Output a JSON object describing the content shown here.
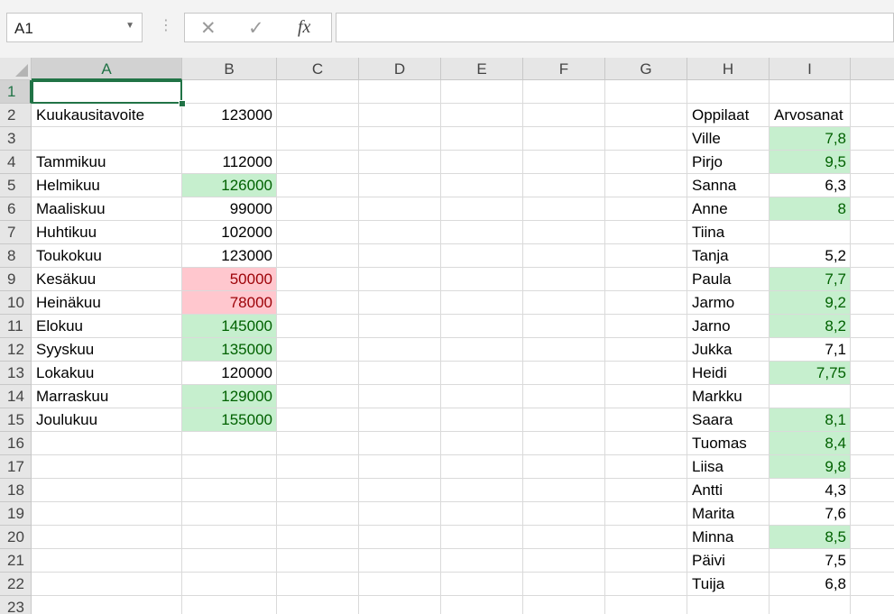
{
  "formula_bar": {
    "name_box": "A1",
    "cancel_icon": "✕",
    "enter_icon": "✓",
    "fx_label": "fx",
    "formula": ""
  },
  "columns": [
    "A",
    "B",
    "C",
    "D",
    "E",
    "F",
    "G",
    "H",
    "I",
    ""
  ],
  "rows": [
    "1",
    "2",
    "3",
    "4",
    "5",
    "6",
    "7",
    "8",
    "9",
    "10",
    "11",
    "12",
    "13",
    "14",
    "15",
    "16",
    "17",
    "18",
    "19",
    "20",
    "21",
    "22",
    "23"
  ],
  "cells": [
    {
      "ref": "A2",
      "value": "Kuukausitavoite",
      "kind": "text"
    },
    {
      "ref": "B2",
      "value": "123000",
      "kind": "num"
    },
    {
      "ref": "A4",
      "value": "Tammikuu",
      "kind": "text"
    },
    {
      "ref": "B4",
      "value": "112000",
      "kind": "num"
    },
    {
      "ref": "A5",
      "value": "Helmikuu",
      "kind": "text"
    },
    {
      "ref": "B5",
      "value": "126000",
      "kind": "num",
      "style": "good"
    },
    {
      "ref": "A6",
      "value": "Maaliskuu",
      "kind": "text"
    },
    {
      "ref": "B6",
      "value": "99000",
      "kind": "num"
    },
    {
      "ref": "A7",
      "value": "Huhtikuu",
      "kind": "text"
    },
    {
      "ref": "B7",
      "value": "102000",
      "kind": "num"
    },
    {
      "ref": "A8",
      "value": "Toukokuu",
      "kind": "text"
    },
    {
      "ref": "B8",
      "value": "123000",
      "kind": "num"
    },
    {
      "ref": "A9",
      "value": "Kesäkuu",
      "kind": "text"
    },
    {
      "ref": "B9",
      "value": "50000",
      "kind": "num",
      "style": "bad"
    },
    {
      "ref": "A10",
      "value": "Heinäkuu",
      "kind": "text"
    },
    {
      "ref": "B10",
      "value": "78000",
      "kind": "num",
      "style": "bad"
    },
    {
      "ref": "A11",
      "value": "Elokuu",
      "kind": "text"
    },
    {
      "ref": "B11",
      "value": "145000",
      "kind": "num",
      "style": "good"
    },
    {
      "ref": "A12",
      "value": "Syyskuu",
      "kind": "text"
    },
    {
      "ref": "B12",
      "value": "135000",
      "kind": "num",
      "style": "good"
    },
    {
      "ref": "A13",
      "value": "Lokakuu",
      "kind": "text"
    },
    {
      "ref": "B13",
      "value": "120000",
      "kind": "num"
    },
    {
      "ref": "A14",
      "value": "Marraskuu",
      "kind": "text"
    },
    {
      "ref": "B14",
      "value": "129000",
      "kind": "num",
      "style": "good"
    },
    {
      "ref": "A15",
      "value": "Joulukuu",
      "kind": "text"
    },
    {
      "ref": "B15",
      "value": "155000",
      "kind": "num",
      "style": "good"
    },
    {
      "ref": "H2",
      "value": "Oppilaat",
      "kind": "text"
    },
    {
      "ref": "I2",
      "value": "Arvosanat",
      "kind": "text"
    },
    {
      "ref": "H3",
      "value": "Ville",
      "kind": "text"
    },
    {
      "ref": "I3",
      "value": "7,8",
      "kind": "num",
      "style": "good"
    },
    {
      "ref": "H4",
      "value": "Pirjo",
      "kind": "text"
    },
    {
      "ref": "I4",
      "value": "9,5",
      "kind": "num",
      "style": "good"
    },
    {
      "ref": "H5",
      "value": "Sanna",
      "kind": "text"
    },
    {
      "ref": "I5",
      "value": "6,3",
      "kind": "num"
    },
    {
      "ref": "H6",
      "value": "Anne",
      "kind": "text"
    },
    {
      "ref": "I6",
      "value": "8",
      "kind": "num",
      "style": "good"
    },
    {
      "ref": "H7",
      "value": "Tiina",
      "kind": "text"
    },
    {
      "ref": "H8",
      "value": "Tanja",
      "kind": "text"
    },
    {
      "ref": "I8",
      "value": "5,2",
      "kind": "num"
    },
    {
      "ref": "H9",
      "value": "Paula",
      "kind": "text"
    },
    {
      "ref": "I9",
      "value": "7,7",
      "kind": "num",
      "style": "good"
    },
    {
      "ref": "H10",
      "value": "Jarmo",
      "kind": "text"
    },
    {
      "ref": "I10",
      "value": "9,2",
      "kind": "num",
      "style": "good"
    },
    {
      "ref": "H11",
      "value": "Jarno",
      "kind": "text"
    },
    {
      "ref": "I11",
      "value": "8,2",
      "kind": "num",
      "style": "good"
    },
    {
      "ref": "H12",
      "value": "Jukka",
      "kind": "text"
    },
    {
      "ref": "I12",
      "value": "7,1",
      "kind": "num"
    },
    {
      "ref": "H13",
      "value": "Heidi",
      "kind": "text"
    },
    {
      "ref": "I13",
      "value": "7,75",
      "kind": "num",
      "style": "good"
    },
    {
      "ref": "H14",
      "value": "Markku",
      "kind": "text"
    },
    {
      "ref": "H15",
      "value": "Saara",
      "kind": "text"
    },
    {
      "ref": "I15",
      "value": "8,1",
      "kind": "num",
      "style": "good"
    },
    {
      "ref": "H16",
      "value": "Tuomas",
      "kind": "text"
    },
    {
      "ref": "I16",
      "value": "8,4",
      "kind": "num",
      "style": "good"
    },
    {
      "ref": "H17",
      "value": "Liisa",
      "kind": "text"
    },
    {
      "ref": "I17",
      "value": "9,8",
      "kind": "num",
      "style": "good"
    },
    {
      "ref": "H18",
      "value": "Antti",
      "kind": "text"
    },
    {
      "ref": "I18",
      "value": "4,3",
      "kind": "num"
    },
    {
      "ref": "H19",
      "value": "Marita",
      "kind": "text"
    },
    {
      "ref": "I19",
      "value": "7,6",
      "kind": "num"
    },
    {
      "ref": "H20",
      "value": "Minna",
      "kind": "text"
    },
    {
      "ref": "I20",
      "value": "8,5",
      "kind": "num",
      "style": "good"
    },
    {
      "ref": "H21",
      "value": "Päivi",
      "kind": "text"
    },
    {
      "ref": "I21",
      "value": "7,5",
      "kind": "num"
    },
    {
      "ref": "H22",
      "value": "Tuija",
      "kind": "text"
    },
    {
      "ref": "I22",
      "value": "6,8",
      "kind": "num"
    }
  ],
  "active_cell": "A1",
  "colors": {
    "good_fill": "#c6efce",
    "good_text": "#006100",
    "bad_fill": "#ffc7ce",
    "bad_text": "#9c0006",
    "accent": "#217346"
  }
}
